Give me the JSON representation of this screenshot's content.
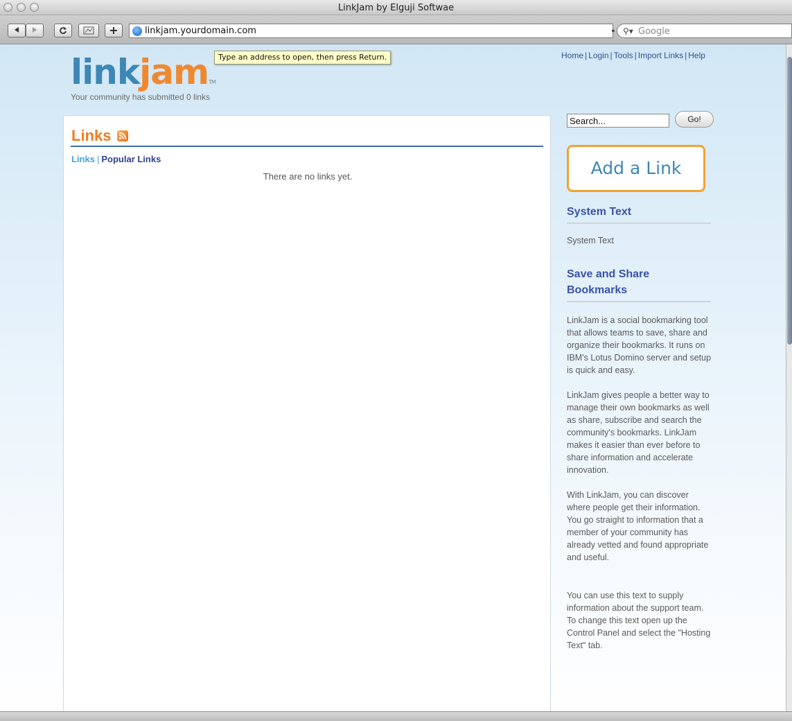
{
  "window": {
    "title": "LinkJam by Elguji Softwae"
  },
  "toolbar": {
    "url": "linkjam.yourdomain.com",
    "search_placeholder": "Google",
    "tooltip": "Type an address to open, then press Return."
  },
  "header": {
    "logo_part1": "link",
    "logo_part2": "jam",
    "logo_tm": "TM",
    "tagline": "Your community has submitted 0 links",
    "nav": [
      "Home",
      "Login",
      "Tools",
      "Import Links",
      "Help"
    ]
  },
  "main": {
    "title": "Links",
    "subnav_current": "Links",
    "subnav_popular": "Popular Links",
    "empty_message": "There are no links yet."
  },
  "sidebar": {
    "search_value": "Search...",
    "go_label": "Go!",
    "add_link_label": "Add a Link",
    "system_heading": "System Text",
    "system_body": "System Text",
    "share_heading_line1": "Save and Share",
    "share_heading_line2": "Bookmarks",
    "paragraphs": [
      [
        "LinkJam is a social bookmarking tool",
        "that allows teams to save, share and",
        "organize their bookmarks. It runs on",
        "IBM's Lotus Domino server and setup",
        "is quick and easy."
      ],
      [
        "LinkJam gives people a better way to",
        "manage their own bookmarks as well",
        "as share, subscribe and search the",
        "community's bookmarks. LinkJam",
        "makes it easier than ever before to",
        "share information and accelerate",
        "innovation."
      ],
      [
        "With LinkJam, you can discover",
        "where people get their information.",
        "You go straight to information that a",
        "member of your community has",
        "already vetted and found appropriate",
        "and useful."
      ],
      [
        "You can use this text to supply",
        "information about the support team.",
        "To change this text open up the",
        "Control Panel and select the \"Hosting",
        "Text\" tab."
      ]
    ]
  },
  "colors": {
    "brand_blue": "#3d87b6",
    "brand_orange": "#f08830",
    "nav_blue": "#2f4e8e",
    "heading_blue": "#3a52a8"
  }
}
